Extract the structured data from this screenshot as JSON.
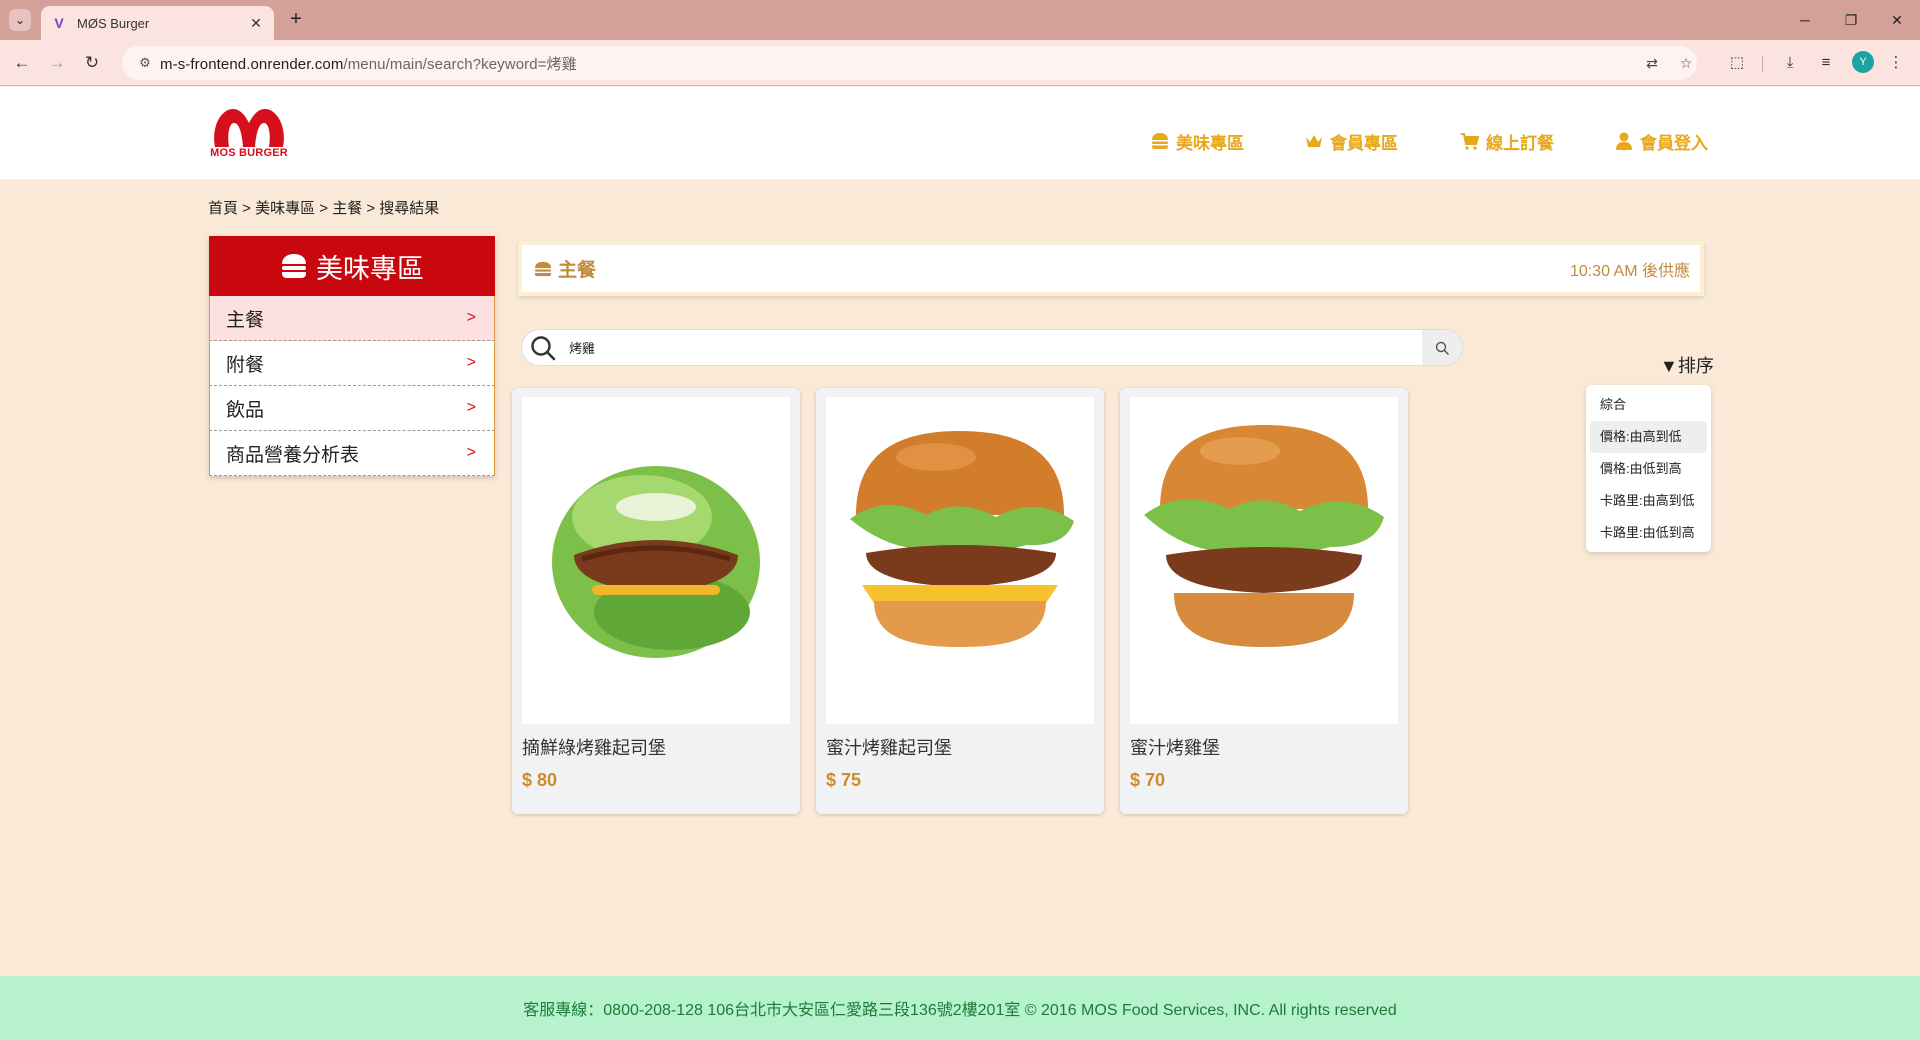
{
  "browser": {
    "tab_title": "MØS Burger",
    "url_host": "m-s-frontend.onrender.com",
    "url_path": "/menu/main/search?keyword=烤雞",
    "avatar_letter": "Y"
  },
  "header": {
    "logo_text": "MOS BURGER",
    "nav": [
      {
        "label": "美味專區",
        "icon": "burger-icon"
      },
      {
        "label": "會員專區",
        "icon": "crown-icon"
      },
      {
        "label": "線上訂餐",
        "icon": "cart-icon"
      },
      {
        "label": "會員登入",
        "icon": "user-icon"
      }
    ]
  },
  "breadcrumb": "首頁 > 美味專區 > 主餐 > 搜尋結果",
  "sidebar": {
    "title": "美味專區",
    "items": [
      {
        "label": "主餐",
        "arrow": ">",
        "active": true
      },
      {
        "label": "附餐",
        "arrow": ">"
      },
      {
        "label": "飲品",
        "arrow": ">"
      },
      {
        "label": "商品營養分析表",
        "arrow": ">"
      }
    ]
  },
  "category": {
    "title": "主餐",
    "time_note": "10:30 AM 後供應"
  },
  "search": {
    "value": "烤雞"
  },
  "sort": {
    "label": "▼排序",
    "options": [
      "綜合",
      "價格:由高到低",
      "價格:由低到高",
      "卡路里:由高到低",
      "卡路里:由低到高"
    ],
    "highlighted": "價格:由高到低"
  },
  "products": [
    {
      "name": "摘鮮綠烤雞起司堡",
      "price": "$ 80",
      "image": "lettuce-wrapped-chicken-burger"
    },
    {
      "name": "蜜汁烤雞起司堡",
      "price": "$ 75",
      "image": "chicken-cheese-burger"
    },
    {
      "name": "蜜汁烤雞堡",
      "price": "$ 70",
      "image": "chicken-burger"
    }
  ],
  "footer": {
    "text": "客服專線：0800-208-128 106台北市大安區仁愛路三段136號2樓201室 © 2016 MOS Food Services, INC. All rights reserved"
  },
  "colors": {
    "brand_red": "#c8070f",
    "accent_gold": "#e7a81a",
    "page_bg": "#fbe9d8",
    "footer_bg": "#b6f2cc",
    "price": "#cf8a2b"
  }
}
